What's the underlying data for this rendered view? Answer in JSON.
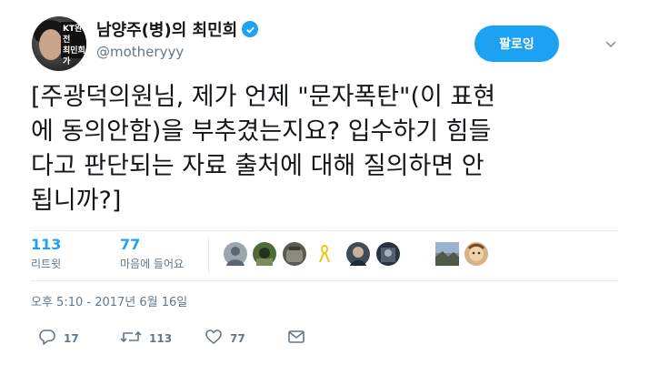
{
  "profile": {
    "display_name": "남양주(병)의 최민희",
    "handle": "@motheryyy",
    "avatar_sign_line1": "KT완전",
    "avatar_sign_line2": "최민희가"
  },
  "follow_button": {
    "label": "팔로잉"
  },
  "tweet": {
    "text_lines": [
      "[주광덕의원님, 제가 언제 \"문자폭탄\"(이 표현",
      "에 동의안함)을 부추겼는지요? 입수하기 힘들",
      "다고 판단되는 자료 출처에 대해 질의하면 안",
      "됩니까?]"
    ]
  },
  "stats": {
    "retweets": {
      "count": "113",
      "label": "리트윗"
    },
    "likes": {
      "count": "77",
      "label": "마음에 들어요"
    }
  },
  "timestamp": "오후 5:10 - 2017년 6월 16일",
  "actions": {
    "reply_count": "17",
    "retweet_count": "113",
    "like_count": "77"
  },
  "colors": {
    "accent": "#1da1f2",
    "secondary_text": "#657786",
    "primary_text": "#14171a"
  }
}
